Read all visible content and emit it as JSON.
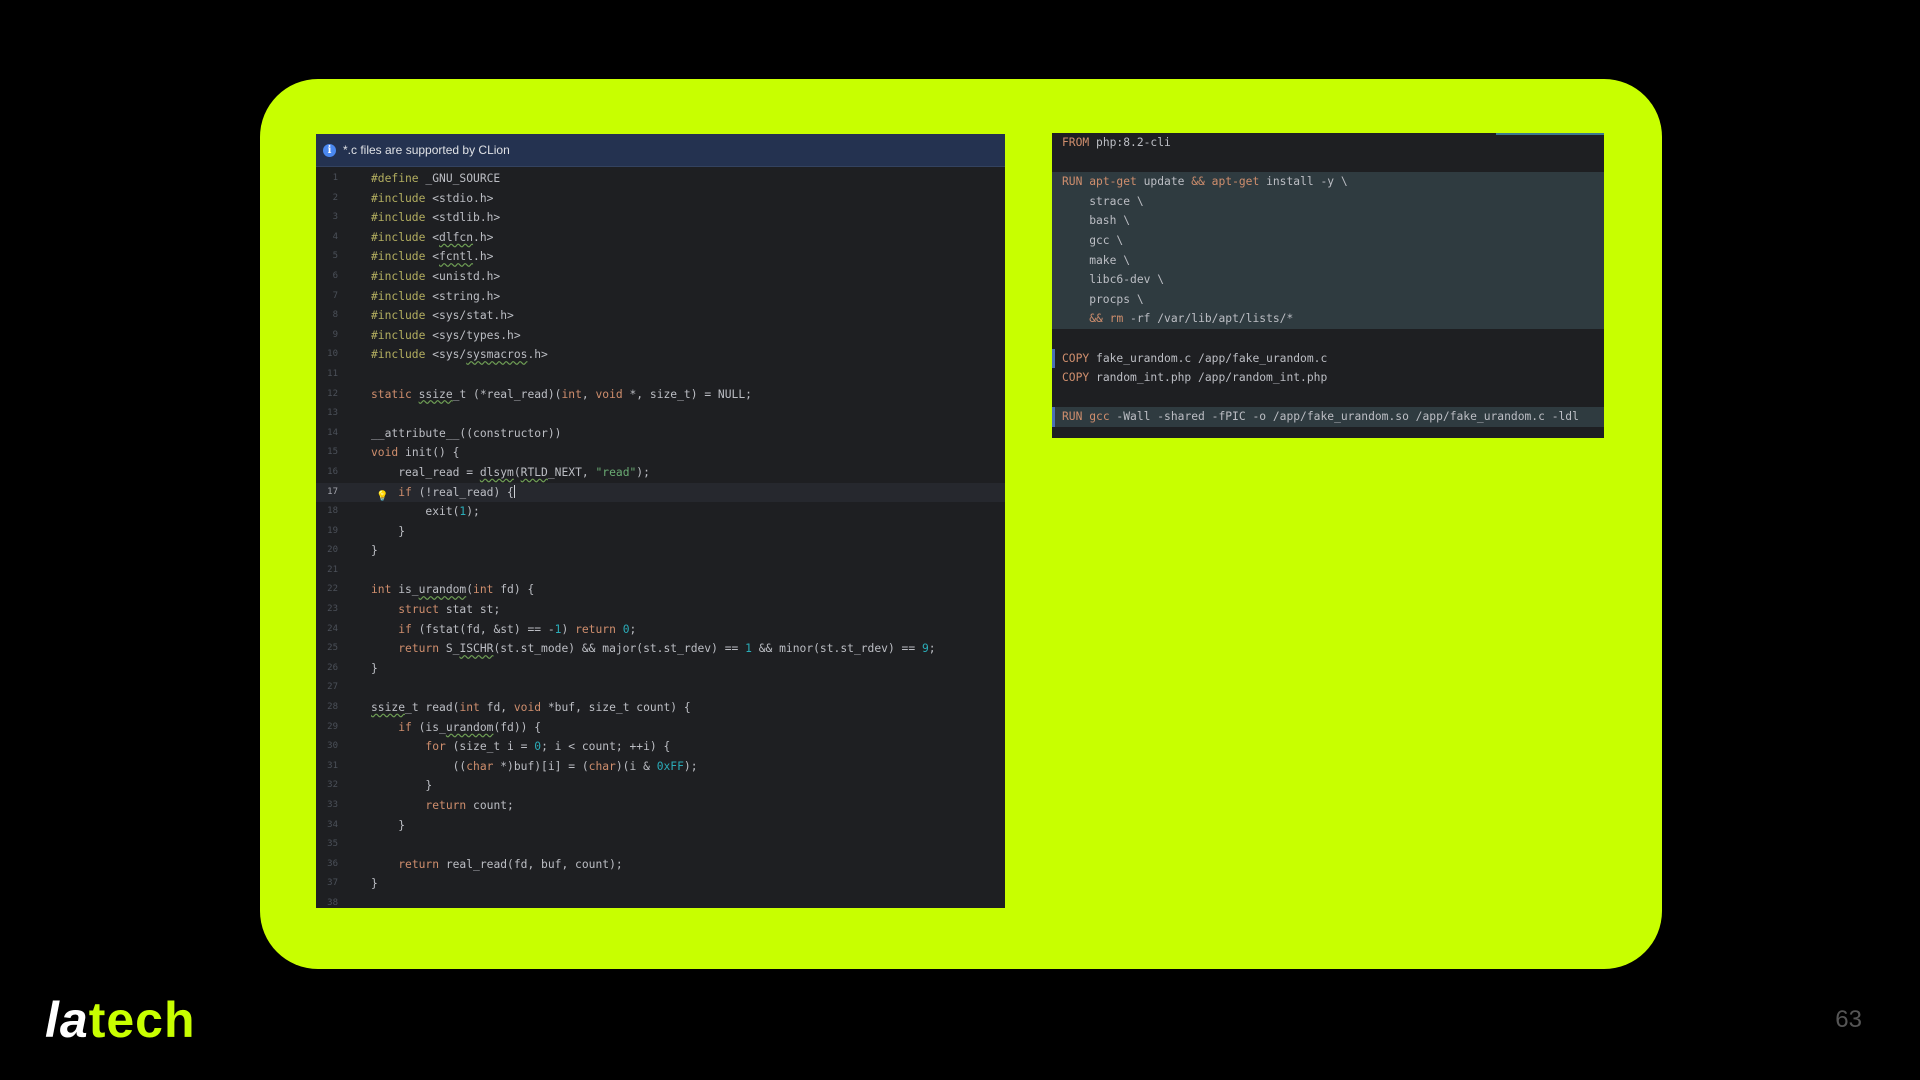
{
  "ide": {
    "banner": "*.c files are supported by CLion",
    "lines": [
      {
        "n": "1",
        "h": "<span class=\"pp\">#define</span> _GNU_SOURCE"
      },
      {
        "n": "2",
        "h": "<span class=\"pp\">#include</span> &lt;stdio.h&gt;"
      },
      {
        "n": "3",
        "h": "<span class=\"pp\">#include</span> &lt;stdlib.h&gt;"
      },
      {
        "n": "4",
        "h": "<span class=\"pp\">#include</span> &lt;<span class=\"u\">dlfcn</span>.h&gt;"
      },
      {
        "n": "5",
        "h": "<span class=\"pp\">#include</span> &lt;<span class=\"u\">fcntl</span>.h&gt;"
      },
      {
        "n": "6",
        "h": "<span class=\"pp\">#include</span> &lt;unistd.h&gt;"
      },
      {
        "n": "7",
        "h": "<span class=\"pp\">#include</span> &lt;string.h&gt;"
      },
      {
        "n": "8",
        "h": "<span class=\"pp\">#include</span> &lt;sys/stat.h&gt;"
      },
      {
        "n": "9",
        "h": "<span class=\"pp\">#include</span> &lt;sys/types.h&gt;"
      },
      {
        "n": "10",
        "h": "<span class=\"pp\">#include</span> &lt;sys/<span class=\"u\">sysmacros</span>.h&gt;"
      },
      {
        "n": "11",
        "h": ""
      },
      {
        "n": "12",
        "h": "<span class=\"kw\">static</span> <span class=\"u\">ssize</span>_t (*real_read)(<span class=\"kw\">int</span>, <span class=\"kw\">void</span> *, size_t) = NULL;"
      },
      {
        "n": "13",
        "h": ""
      },
      {
        "n": "14",
        "h": "__attribute__((constructor))"
      },
      {
        "n": "15",
        "h": "<span class=\"kw\">void</span> init() {"
      },
      {
        "n": "16",
        "h": "    real_read = <span class=\"u\">dlsym</span>(<span class=\"u\">RTLD</span>_NEXT, <span class=\"str\">\"read\"</span>);"
      },
      {
        "n": "17",
        "h": "    <span class=\"kw\">if</span> (!real_read) {<span class=\"caret\"></span>",
        "active": true,
        "bulb": true
      },
      {
        "n": "18",
        "h": "        exit(<span class=\"num\">1</span>);"
      },
      {
        "n": "19",
        "h": "    }"
      },
      {
        "n": "20",
        "h": "}"
      },
      {
        "n": "21",
        "h": ""
      },
      {
        "n": "22",
        "h": "<span class=\"kw\">int</span> is_<span class=\"u\">urandom</span>(<span class=\"kw\">int</span> fd) {"
      },
      {
        "n": "23",
        "h": "    <span class=\"kw\">struct</span> stat st;"
      },
      {
        "n": "24",
        "h": "    <span class=\"kw\">if</span> (fstat(fd, &amp;st) == -<span class=\"num\">1</span>) <span class=\"kw\">return</span> <span class=\"num\">0</span>;"
      },
      {
        "n": "25",
        "h": "    <span class=\"kw\">return</span> S_<span class=\"u\">ISCHR</span>(st.st_mode) &amp;&amp; major(st.st_rdev) == <span class=\"num\">1</span> &amp;&amp; minor(st.st_rdev) == <span class=\"num\">9</span>;"
      },
      {
        "n": "26",
        "h": "}"
      },
      {
        "n": "27",
        "h": ""
      },
      {
        "n": "28",
        "h": "<span class=\"u\">ssize</span>_t read(<span class=\"kw\">int</span> fd, <span class=\"kw\">void</span> *buf, size_t count) {"
      },
      {
        "n": "29",
        "h": "    <span class=\"kw\">if</span> (is_<span class=\"u\">urandom</span>(fd)) {"
      },
      {
        "n": "30",
        "h": "        <span class=\"kw\">for</span> (size_t i = <span class=\"num\">0</span>; i &lt; count; ++i) {"
      },
      {
        "n": "31",
        "h": "            ((<span class=\"kw\">char</span> *)buf)[i] = (<span class=\"kw\">char</span>)(i &amp; <span class=\"num\">0xFF</span>);"
      },
      {
        "n": "32",
        "h": "        }"
      },
      {
        "n": "33",
        "h": "        <span class=\"kw\">return</span> count;"
      },
      {
        "n": "34",
        "h": "    }"
      },
      {
        "n": "35",
        "h": ""
      },
      {
        "n": "36",
        "h": "    <span class=\"kw\">return</span> real_read(fd, buf, count);"
      },
      {
        "n": "37",
        "h": "}"
      },
      {
        "n": "38",
        "h": ""
      }
    ]
  },
  "docker": {
    "lines": [
      {
        "h": "<span class=\"dk\">FROM</span> php:8.2-cli"
      },
      {
        "h": ""
      },
      {
        "h": "<span class=\"dk\">RUN</span> <span class=\"dk\">apt-get</span> update <span class=\"dk\">&amp;&amp;</span> <span class=\"dk\">apt-get</span> install -y \\",
        "hl": true
      },
      {
        "h": "    strace \\",
        "hl": true
      },
      {
        "h": "    bash \\",
        "hl": true
      },
      {
        "h": "    gcc \\",
        "hl": true
      },
      {
        "h": "    make \\",
        "hl": true
      },
      {
        "h": "    libc6-dev \\",
        "hl": true
      },
      {
        "h": "    procps \\",
        "hl": true
      },
      {
        "h": "    <span class=\"dk\">&amp;&amp;</span> <span class=\"dk\">rm</span> -rf /var/lib/apt/lists/*",
        "hl": true
      },
      {
        "h": ""
      },
      {
        "h": "<span class=\"dk\">COPY</span> fake_urandom.c /app/fake_urandom.c",
        "mark": true
      },
      {
        "h": "<span class=\"dk\">COPY</span> random_int.php /app/random_int.php"
      },
      {
        "h": ""
      },
      {
        "h": "<span class=\"dk\">RUN</span> <span class=\"dk\">gcc</span> -Wall -shared -fPIC -o /app/fake_urandom.so /app/fake_urandom.c -ldl",
        "mark": true,
        "hl": true
      }
    ]
  },
  "logo": {
    "part1": "la",
    "part2": "tech"
  },
  "page_number": "63"
}
